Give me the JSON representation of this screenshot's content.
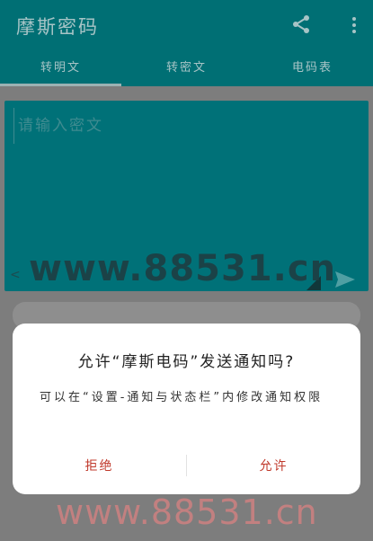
{
  "app": {
    "title": "摩斯密码",
    "actions": {
      "share_icon": "share-icon",
      "more_icon": "more-vert-icon"
    }
  },
  "tabs": [
    {
      "label": "转明文",
      "selected": true
    },
    {
      "label": "转密文",
      "selected": false
    },
    {
      "label": "电码表",
      "selected": false
    }
  ],
  "editor": {
    "placeholder": "请输入密文",
    "value": "",
    "left_mark": "<"
  },
  "dialog": {
    "title": "允许“摩斯电码”发送通知吗?",
    "message": "可以在“设置-通知与状态栏”内修改通知权限",
    "deny_label": "拒绝",
    "allow_label": "允许"
  },
  "watermarks": {
    "top": "www.88531.cn",
    "bottom": "www.88531.cn"
  },
  "colors": {
    "app_bar": "#006f74",
    "editor_bg": "#007178",
    "button_text": "#c0392b",
    "dialog_bg": "#ffffff"
  }
}
